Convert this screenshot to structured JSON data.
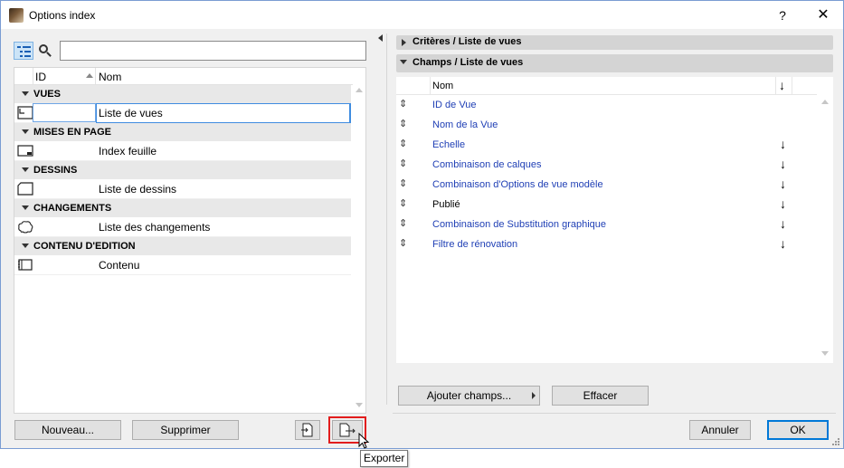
{
  "window": {
    "title": "Options index"
  },
  "titlebar": {
    "help_glyph": "?",
    "close_glyph": "✕"
  },
  "tree": {
    "columns": {
      "id": "ID",
      "name": "Nom"
    },
    "groups": [
      {
        "label": "VUES",
        "items": [
          {
            "id": "",
            "name": "Liste de vues",
            "icon": "view-list-icon",
            "selected": true
          }
        ]
      },
      {
        "label": "MISES EN PAGE",
        "items": [
          {
            "id": "",
            "name": "Index feuille",
            "icon": "layout-sheet-icon"
          }
        ]
      },
      {
        "label": "DESSINS",
        "items": [
          {
            "id": "",
            "name": "Liste de dessins",
            "icon": "drawing-icon"
          }
        ]
      },
      {
        "label": "CHANGEMENTS",
        "items": [
          {
            "id": "",
            "name": "Liste des changements",
            "icon": "revision-cloud-icon"
          }
        ]
      },
      {
        "label": "CONTENU D'EDITION",
        "items": [
          {
            "id": "",
            "name": "Contenu",
            "icon": "book-icon"
          }
        ]
      }
    ]
  },
  "left_buttons": {
    "new": "Nouveau...",
    "delete": "Supprimer"
  },
  "right": {
    "criteria_header": "Critères /  Liste de vues",
    "fields_header": "Champs /  Liste de vues",
    "fields_col_name": "Nom",
    "sort_glyph": "↓",
    "drag_glyph": "⇕",
    "fields": [
      {
        "name": "ID de Vue",
        "link": true,
        "sort": ""
      },
      {
        "name": "Nom de la Vue",
        "link": true,
        "sort": ""
      },
      {
        "name": "Echelle",
        "link": true,
        "sort": "↓"
      },
      {
        "name": "Combinaison de calques",
        "link": true,
        "sort": "↓"
      },
      {
        "name": "Combinaison d'Options de vue modèle",
        "link": true,
        "sort": "↓"
      },
      {
        "name": "Publié",
        "link": false,
        "sort": "↓"
      },
      {
        "name": "Combinaison de Substitution graphique",
        "link": true,
        "sort": "↓"
      },
      {
        "name": "Filtre de rénovation",
        "link": true,
        "sort": "↓"
      }
    ],
    "add_fields": "Ajouter champs...",
    "clear": "Effacer"
  },
  "footer": {
    "cancel": "Annuler",
    "ok": "OK"
  },
  "tooltip": {
    "text": "Exporter"
  },
  "colors": {
    "link": "#1f3fb5",
    "highlight": "#e21d1d",
    "default_button_border": "#0078d7",
    "selection_border": "#3f8ce0"
  }
}
